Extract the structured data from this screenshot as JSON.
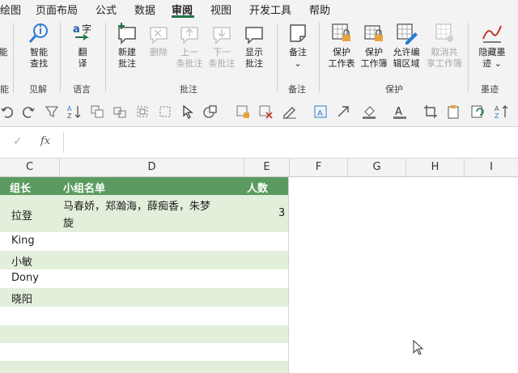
{
  "menu": {
    "items": [
      "绘图",
      "页面布局",
      "公式",
      "数据",
      "审阅",
      "视图",
      "开发工具",
      "帮助"
    ],
    "active": "审阅"
  },
  "ribbon": {
    "buttons": [
      {
        "line1": "能",
        "line2": ""
      },
      {
        "line1": "智能",
        "line2": "查找"
      },
      {
        "line1": "翻",
        "line2": "译"
      },
      {
        "line1": "新建",
        "line2": "批注"
      },
      {
        "line1": "删除",
        "line2": ""
      },
      {
        "line1": "上一",
        "line2": "条批注"
      },
      {
        "line1": "下一",
        "line2": "条批注"
      },
      {
        "line1": "显示",
        "line2": "批注"
      },
      {
        "line1": "备注",
        "line2": "⌄"
      },
      {
        "line1": "保护",
        "line2": "工作表"
      },
      {
        "line1": "保护",
        "line2": "工作簿"
      },
      {
        "line1": "允许编",
        "line2": "辑区域"
      },
      {
        "line1": "取消共",
        "line2": "享工作簿"
      },
      {
        "line1": "隐藏墨",
        "line2": "迹 ⌄"
      }
    ],
    "groups": [
      "能",
      "见解",
      "语言",
      "批注",
      "备注",
      "保护",
      "墨迹"
    ]
  },
  "formula_bar": {
    "cancel": "✓",
    "fx": "fx",
    "value": ""
  },
  "columns": [
    "C",
    "D",
    "E",
    "F",
    "G",
    "H",
    "I"
  ],
  "table": {
    "headers": {
      "c": "组长",
      "d": "小组名单",
      "e": "人数"
    },
    "rows": [
      {
        "c": "拉登",
        "d1": "马春娇，郑瀚海，薛痴香，朱梦",
        "d2": "旋",
        "e": "3"
      },
      {
        "c": "King",
        "d1": "",
        "d2": "",
        "e": ""
      },
      {
        "c": "小敏",
        "d1": "",
        "d2": "",
        "e": ""
      },
      {
        "c": "Dony",
        "d1": "",
        "d2": "",
        "e": ""
      },
      {
        "c": "晓阳",
        "d1": "",
        "d2": "",
        "e": ""
      }
    ]
  },
  "colors": {
    "header_fill": "#5b9b5f",
    "band_fill": "#e2efda",
    "accent": "#217346"
  }
}
